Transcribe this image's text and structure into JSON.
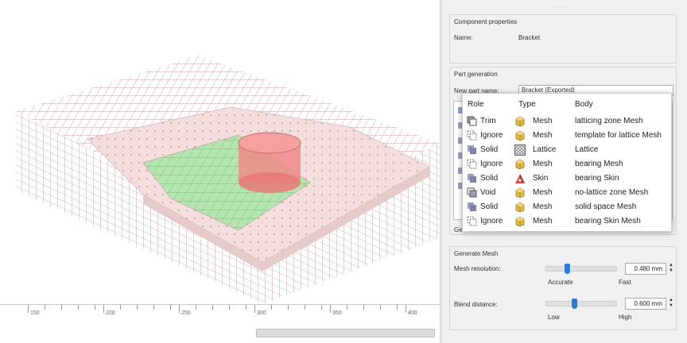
{
  "ruler": {
    "labels": [
      "150",
      "200",
      "250",
      "300",
      "350",
      "400"
    ]
  },
  "panel": {
    "component_properties": {
      "title": "Component properties",
      "name_label": "Name:",
      "name_value": "Bracket"
    },
    "part_generation": {
      "title": "Part generation",
      "new_part_label": "New part name:",
      "new_part_value": "Bracket (Exported)",
      "ge_label": "Ge"
    },
    "generate_mesh": {
      "title": "Generate Mesh",
      "mesh_resolution": {
        "label": "Mesh resolution:",
        "value": "0.480",
        "unit": "mm",
        "left_caption": "Accurate",
        "right_caption": "Fast",
        "level": 0.2
      },
      "blend_distance": {
        "label": "Blend distance:",
        "value": "0.600",
        "unit": "mm",
        "left_caption": "Low",
        "right_caption": "High",
        "level": 0.35
      }
    }
  },
  "popup": {
    "headers": {
      "role": "Role",
      "type": "Type",
      "body": "Body"
    },
    "rows": [
      {
        "role": "Trim",
        "role_icon": "trim-icon",
        "type": "Mesh",
        "type_icon": "mesh-cube-icon",
        "body": "latticing zone Mesh"
      },
      {
        "role": "Ignore",
        "role_icon": "ignore-icon",
        "type": "Mesh",
        "type_icon": "mesh-cube-icon",
        "body": "template for lattice Mesh"
      },
      {
        "role": "Solid",
        "role_icon": "solid-icon",
        "type": "Lattice",
        "type_icon": "lattice-icon",
        "body": "Lattice"
      },
      {
        "role": "Ignore",
        "role_icon": "ignore-icon",
        "type": "Mesh",
        "type_icon": "mesh-cube-icon",
        "body": "bearing Mesh"
      },
      {
        "role": "Solid",
        "role_icon": "solid-icon",
        "type": "Skin",
        "type_icon": "skin-icon",
        "body": "bearing Skin"
      },
      {
        "role": "Void",
        "role_icon": "void-icon",
        "type": "Mesh",
        "type_icon": "mesh-cube-icon",
        "body": "no-lattice zone Mesh"
      },
      {
        "role": "Solid",
        "role_icon": "solid-icon",
        "type": "Mesh",
        "type_icon": "mesh-cube-icon",
        "body": "solid space Mesh"
      },
      {
        "role": "Ignore",
        "role_icon": "ignore-icon",
        "type": "Mesh",
        "type_icon": "mesh-cube-icon",
        "body": "bearing Skin Mesh"
      }
    ]
  },
  "colors": {
    "lattice": "#c9a6a6",
    "plate": "#f5dede",
    "inner_lattice": "#b6e6b0",
    "cylinder": "#f08a8a",
    "accent": "#2b7bd3"
  }
}
